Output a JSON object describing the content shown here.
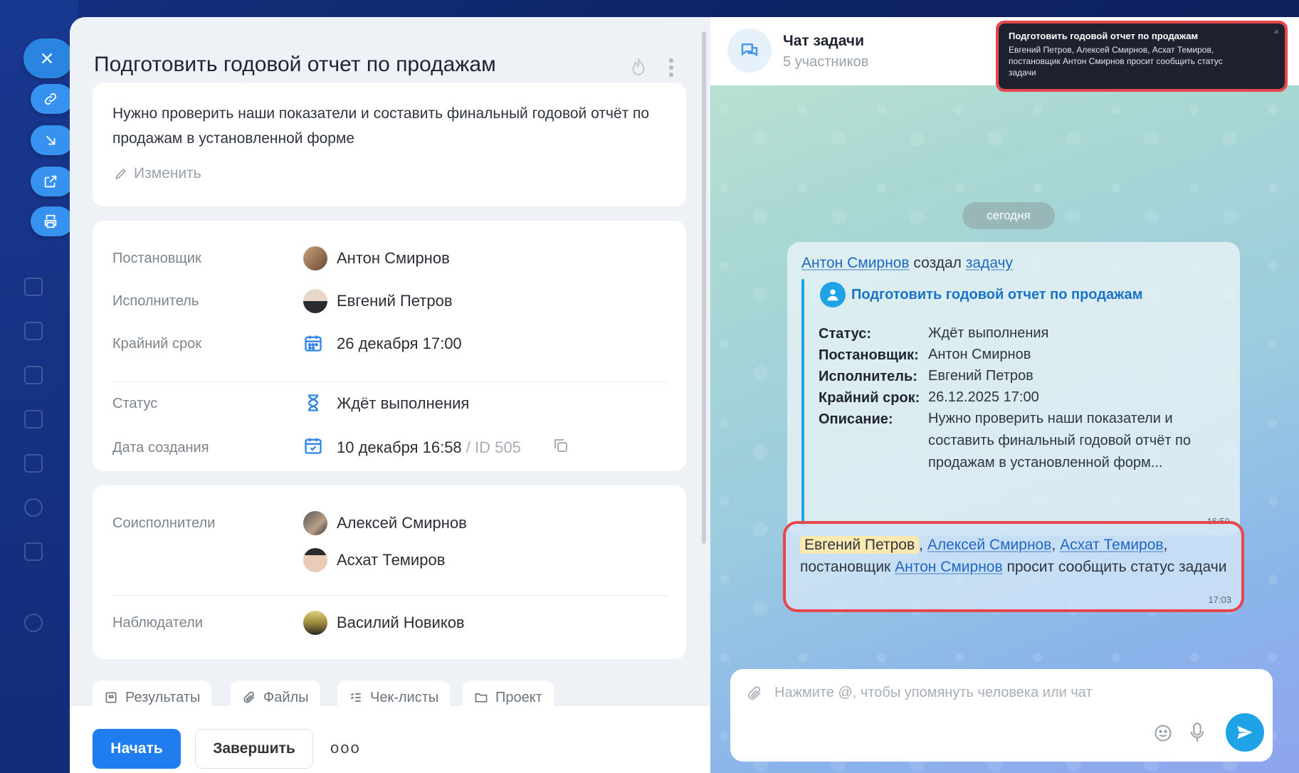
{
  "task": {
    "title": "Подготовить годовой отчет по продажам",
    "description": "Нужно проверить наши показатели и составить финальный годовой отчёт по продажам в установленной форме",
    "edit_label": "Изменить",
    "fields": {
      "creator_label": "Постановщик",
      "creator_value": "Антон Смирнов",
      "assignee_label": "Исполнитель",
      "assignee_value": "Евгений Петров",
      "deadline_label": "Крайний срок",
      "deadline_value": "26 декабря 17:00",
      "status_label": "Статус",
      "status_value": "Ждёт выполнения",
      "created_label": "Дата создания",
      "created_value": "10 декабря 16:58",
      "id_sep": "/",
      "id_value": "ID 505"
    },
    "people": {
      "coassignees_label": "Соисполнители",
      "coassignees": [
        "Алексей Смирнов",
        "Асхат Темиров"
      ],
      "observers_label": "Наблюдатели",
      "observers": [
        "Василий Новиков"
      ]
    },
    "tabs": [
      "Результаты",
      "Файлы",
      "Чек-листы",
      "Проект"
    ],
    "buttons": {
      "start": "Начать",
      "finish": "Завершить",
      "more": "ooo"
    }
  },
  "chat": {
    "title": "Чат задачи",
    "subtitle": "5 участников",
    "date_separator": "сегодня",
    "message1": {
      "author": "Антон Смирнов",
      "action": "создал",
      "object": "задачу",
      "task_title": "Подготовить годовой отчет по продажам",
      "rows": [
        {
          "k": "Статус:",
          "v": "Ждёт выполнения"
        },
        {
          "k": "Постановщик:",
          "v": "Антон Смирнов"
        },
        {
          "k": "Исполнитель:",
          "v": "Евгений Петров"
        },
        {
          "k": "Крайний срок:",
          "v": "26.12.2025 17:00"
        },
        {
          "k": "Описание:",
          "v": "Нужно проверить наши показатели и составить финальный годовой отчёт по продажам в установленной форм..."
        }
      ],
      "time": "16:59"
    },
    "message2": {
      "mention_self": "Евгений Петров",
      "sep1": ",",
      "mention2": "Алексей Смирнов",
      "sep2": ",",
      "mention3": "Асхат Темиров",
      "sep3": ",",
      "text_a": "постановщик",
      "mention4": "Антон Смирнов",
      "text_b": "просит сообщить статус задачи",
      "time": "17:03"
    },
    "composer_placeholder": "Нажмите @, чтобы упомянуть человека или чат"
  },
  "notification": {
    "title": "Подготовить годовой отчет по продажам",
    "body": "Евгений Петров, Алексей Смирнов, Асхат Темиров, постановщик Антон Смирнов просит сообщить статус задачи",
    "close": "×"
  },
  "colors": {
    "primary": "#1f7df0",
    "accent": "#1fa3e6",
    "highlight": "#e8464d",
    "link": "#2066c4"
  },
  "icons": [
    "close-icon",
    "link-icon",
    "arrow-down-right-icon",
    "external-link-icon",
    "printer-icon",
    "flame-icon",
    "kebab-menu-icon",
    "pencil-icon",
    "calendar-icon",
    "hourglass-icon",
    "calendar-check-icon",
    "copy-icon",
    "chat-icon",
    "user-icon",
    "paperclip-icon",
    "smile-icon",
    "microphone-icon",
    "send-icon"
  ]
}
